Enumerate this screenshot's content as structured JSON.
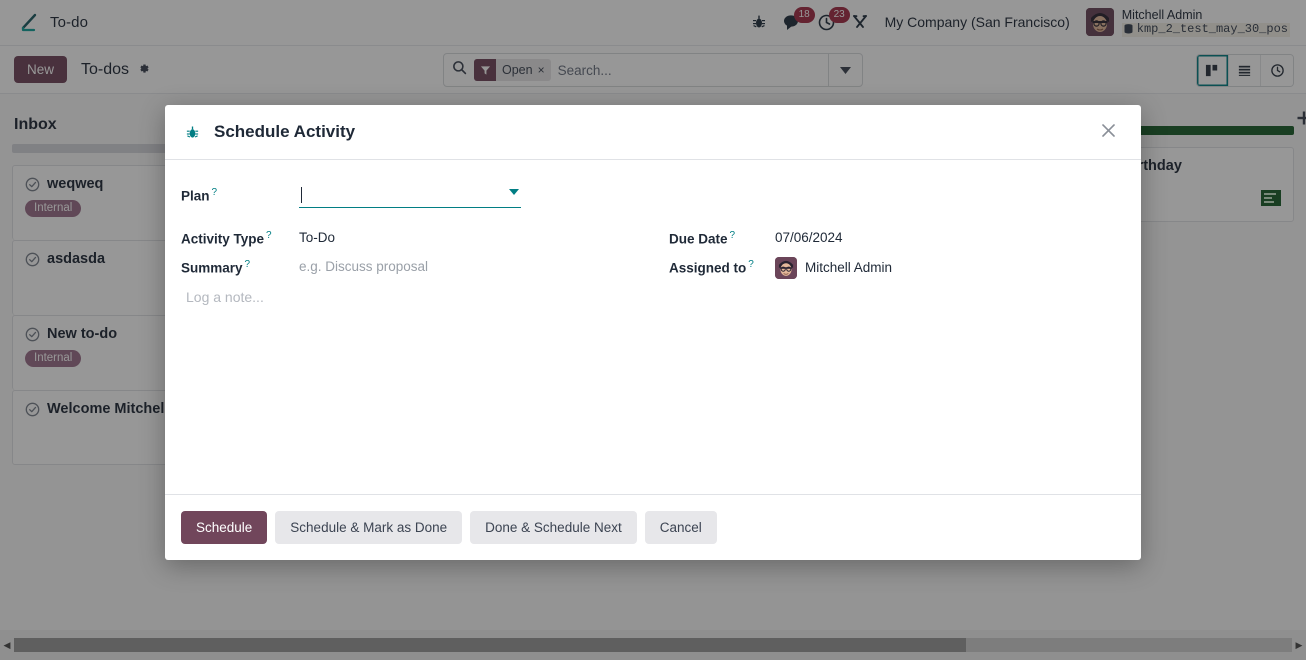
{
  "navbar": {
    "brand_icon": "pencil-icon",
    "brand_name": "To-do",
    "bug_icon": "bug-icon",
    "messages": {
      "icon": "chat-bubble-icon",
      "count": "18"
    },
    "activities": {
      "icon": "clock-icon",
      "count": "23"
    },
    "tools_icon": "wrench-icon",
    "company": "My Company (San Francisco)",
    "user_name": "Mitchell Admin",
    "db_icon": "database-icon",
    "database": "kmp_2_test_may_30_pos"
  },
  "control_panel": {
    "new_label": "New",
    "breadcrumb": "To-dos",
    "gear_icon": "gear-icon",
    "search": {
      "icon": "search-icon",
      "facet_icon": "filter-icon",
      "facet_label": "Open",
      "facet_remove": "×",
      "placeholder": "Search...",
      "dropdown_icon": "chevron-down-icon"
    },
    "views": [
      {
        "name": "kanban",
        "icon": "kanban-icon",
        "active": true
      },
      {
        "name": "list",
        "icon": "list-icon",
        "active": false
      },
      {
        "name": "activity",
        "icon": "clock-icon",
        "active": false
      }
    ]
  },
  "kanban": {
    "columns": [
      {
        "title": "Inbox",
        "progress": "grey",
        "cards": [
          {
            "title": "weqweq",
            "tag": "Internal"
          },
          {
            "title": "asdasda",
            "tag": ""
          },
          {
            "title": "New to-do",
            "tag": "Internal"
          },
          {
            "title": "Welcome Mitchell",
            "tag": ""
          }
        ]
      },
      {
        "title": "",
        "progress": "green",
        "cards": [
          {
            "title": "Marc Demo's birthday",
            "tag": ""
          }
        ]
      }
    ],
    "add_column_icon": "plus-icon"
  },
  "scrollbar": {
    "left_arrow": "◀",
    "right_arrow": "▶"
  },
  "dialog": {
    "icon": "bug-icon",
    "title": "Schedule Activity",
    "close_icon": "close-icon",
    "fields": {
      "plan_label": "Plan",
      "plan_value": "",
      "plan_dropdown_icon": "chevron-down-icon",
      "activity_type_label": "Activity Type",
      "activity_type_value": "To-Do",
      "summary_label": "Summary",
      "summary_placeholder": "e.g. Discuss proposal",
      "due_date_label": "Due Date",
      "due_date_value": "07/06/2024",
      "assigned_to_label": "Assigned to",
      "assigned_to_value": "Mitchell Admin",
      "note_placeholder": "Log a note...",
      "help_marker": "?"
    },
    "buttons": [
      {
        "label": "Schedule",
        "primary": true
      },
      {
        "label": "Schedule & Mark as Done",
        "primary": false
      },
      {
        "label": "Done & Schedule Next",
        "primary": false
      },
      {
        "label": "Cancel",
        "primary": false
      }
    ]
  },
  "colors": {
    "primary": "#71465b",
    "accent": "#017e84",
    "badge": "#a32d45",
    "tag": "#9c6f8a",
    "progress_green": "#1b5e2a"
  }
}
